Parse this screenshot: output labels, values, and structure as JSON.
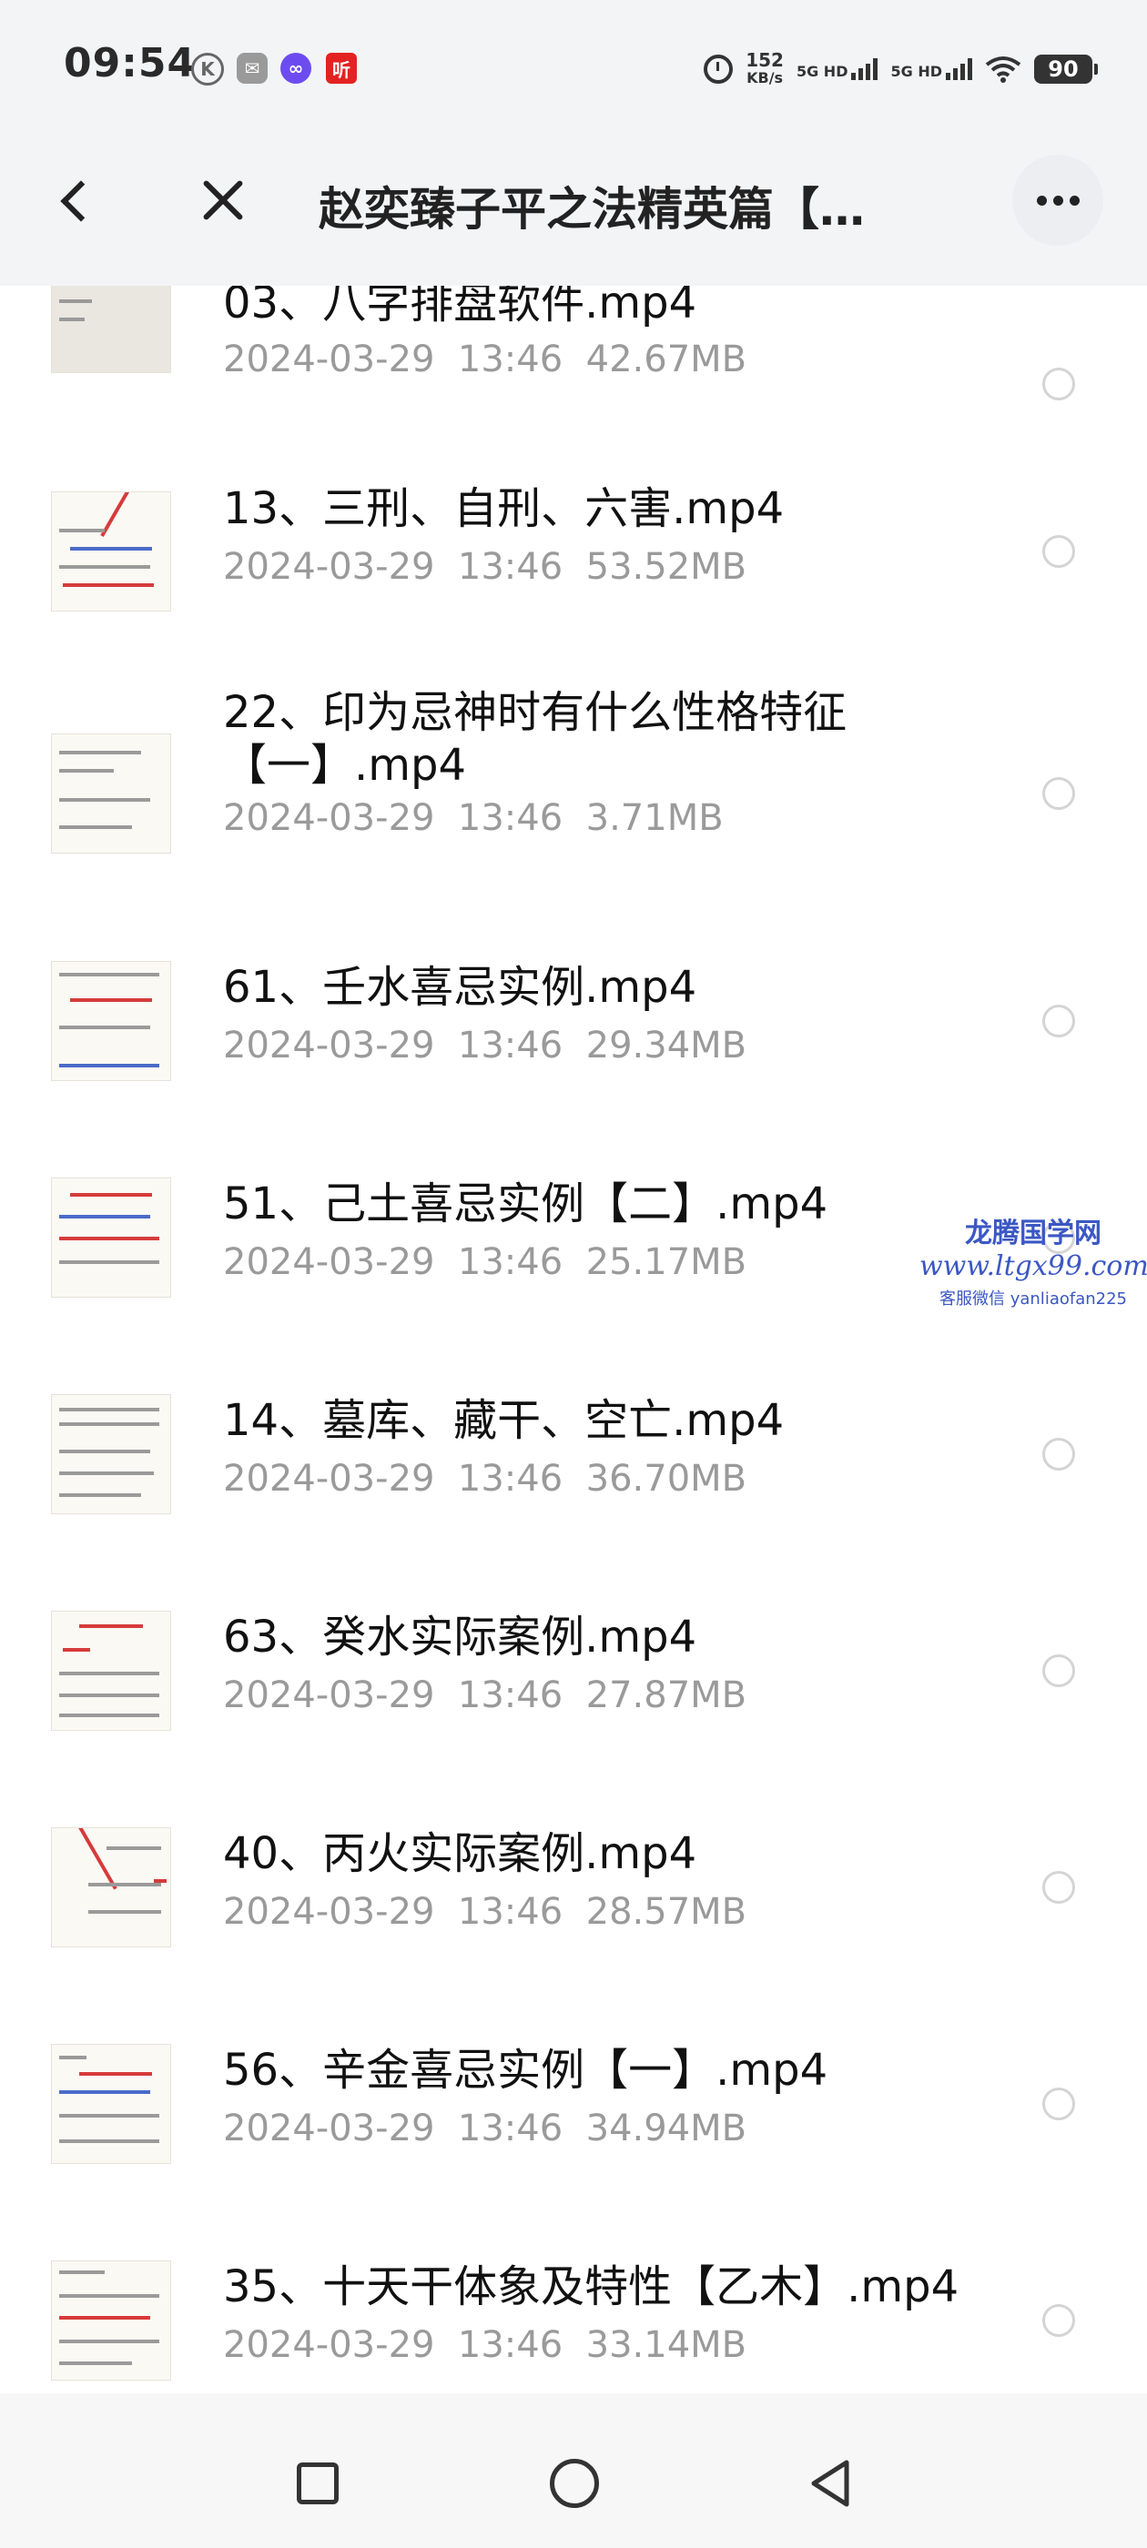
{
  "status_bar": {
    "time": "09:54",
    "app_icons": [
      "K",
      "✉",
      "∞",
      "听"
    ],
    "net_speed_value": "152",
    "net_speed_unit": "KB/s",
    "signal_1": "5G HD",
    "signal_2": "5G HD",
    "battery": "90"
  },
  "header": {
    "title": "赵奕臻子平之法精英篇【…"
  },
  "files": [
    {
      "name": "03、八字排盘软件.mp4",
      "date": "2024-03-29",
      "time": "13:46",
      "size": "42.67MB"
    },
    {
      "name": "13、三刑、自刑、六害.mp4",
      "date": "2024-03-29",
      "time": "13:46",
      "size": "53.52MB"
    },
    {
      "name": "22、印为忌神时有什么性格特征【一】.mp4",
      "date": "2024-03-29",
      "time": "13:46",
      "size": "3.71MB"
    },
    {
      "name": "61、壬水喜忌实例.mp4",
      "date": "2024-03-29",
      "time": "13:46",
      "size": "29.34MB"
    },
    {
      "name": "51、己土喜忌实例【二】.mp4",
      "date": "2024-03-29",
      "time": "13:46",
      "size": "25.17MB"
    },
    {
      "name": "14、墓库、藏干、空亡.mp4",
      "date": "2024-03-29",
      "time": "13:46",
      "size": "36.70MB"
    },
    {
      "name": "63、癸水实际案例.mp4",
      "date": "2024-03-29",
      "time": "13:46",
      "size": "27.87MB"
    },
    {
      "name": "40、丙火实际案例.mp4",
      "date": "2024-03-29",
      "time": "13:46",
      "size": "28.57MB"
    },
    {
      "name": "56、辛金喜忌实例【一】.mp4",
      "date": "2024-03-29",
      "time": "13:46",
      "size": "34.94MB"
    },
    {
      "name": "35、十天干体象及特性【乙木】.mp4",
      "date": "2024-03-29",
      "time": "13:46",
      "size": "33.14MB"
    }
  ],
  "watermark": {
    "name": "龙腾国学网",
    "url": "www.ltgx99.com",
    "contact": "客服微信 yanliaofan225"
  },
  "colors": {
    "header_bg": "#f3f4f6",
    "meta_text": "#9a9a9a",
    "watermark": "#3b57c4"
  }
}
